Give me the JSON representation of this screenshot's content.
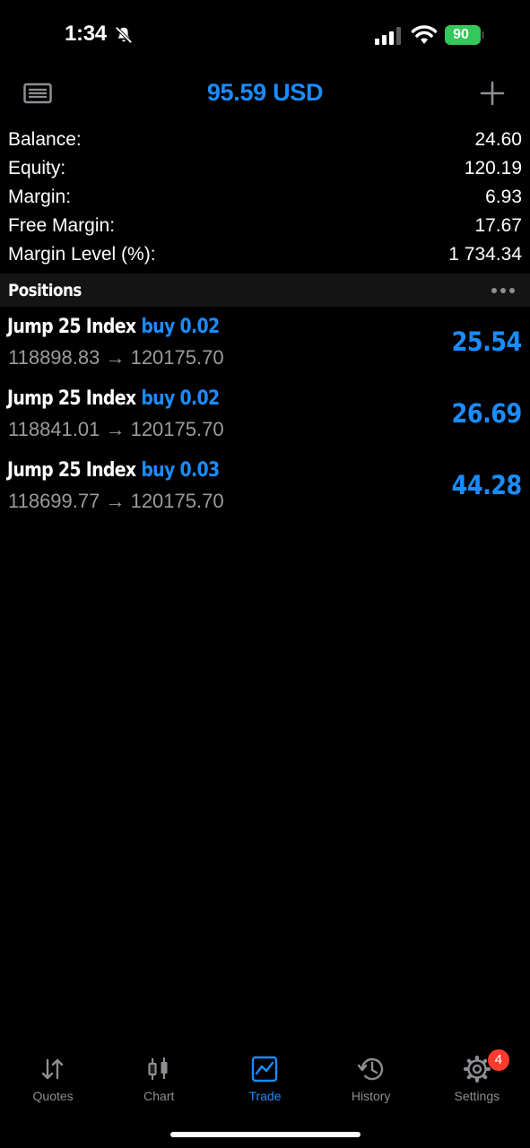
{
  "status_bar": {
    "time": "1:34",
    "battery": "90"
  },
  "header": {
    "title": "95.59 USD"
  },
  "summary": [
    {
      "label": "Balance:",
      "value": "24.60"
    },
    {
      "label": "Equity:",
      "value": "120.19"
    },
    {
      "label": "Margin:",
      "value": "6.93"
    },
    {
      "label": "Free Margin:",
      "value": "17.67"
    },
    {
      "label": "Margin Level (%):",
      "value": "1 734.34"
    }
  ],
  "positions": {
    "title": "Positions",
    "items": [
      {
        "symbol": "Jump 25 Index",
        "side": "buy 0.02",
        "prices": "118898.83 → 120175.70",
        "profit": "25.54"
      },
      {
        "symbol": "Jump 25 Index",
        "side": "buy 0.02",
        "prices": "118841.01 → 120175.70",
        "profit": "26.69"
      },
      {
        "symbol": "Jump 25 Index",
        "side": "buy 0.03",
        "prices": "118699.77 → 120175.70",
        "profit": "44.28"
      }
    ]
  },
  "tabs": [
    {
      "label": "Quotes",
      "icon": "quotes-icon"
    },
    {
      "label": "Chart",
      "icon": "chart-icon"
    },
    {
      "label": "Trade",
      "icon": "trade-icon",
      "active": true
    },
    {
      "label": "History",
      "icon": "history-icon"
    },
    {
      "label": "Settings",
      "icon": "settings-icon",
      "badge": "4"
    }
  ],
  "colors": {
    "accent": "#1a8cff",
    "background": "#000000",
    "secondary_text": "#9b9b9f",
    "badge": "#ff3b30",
    "battery": "#34c759"
  }
}
